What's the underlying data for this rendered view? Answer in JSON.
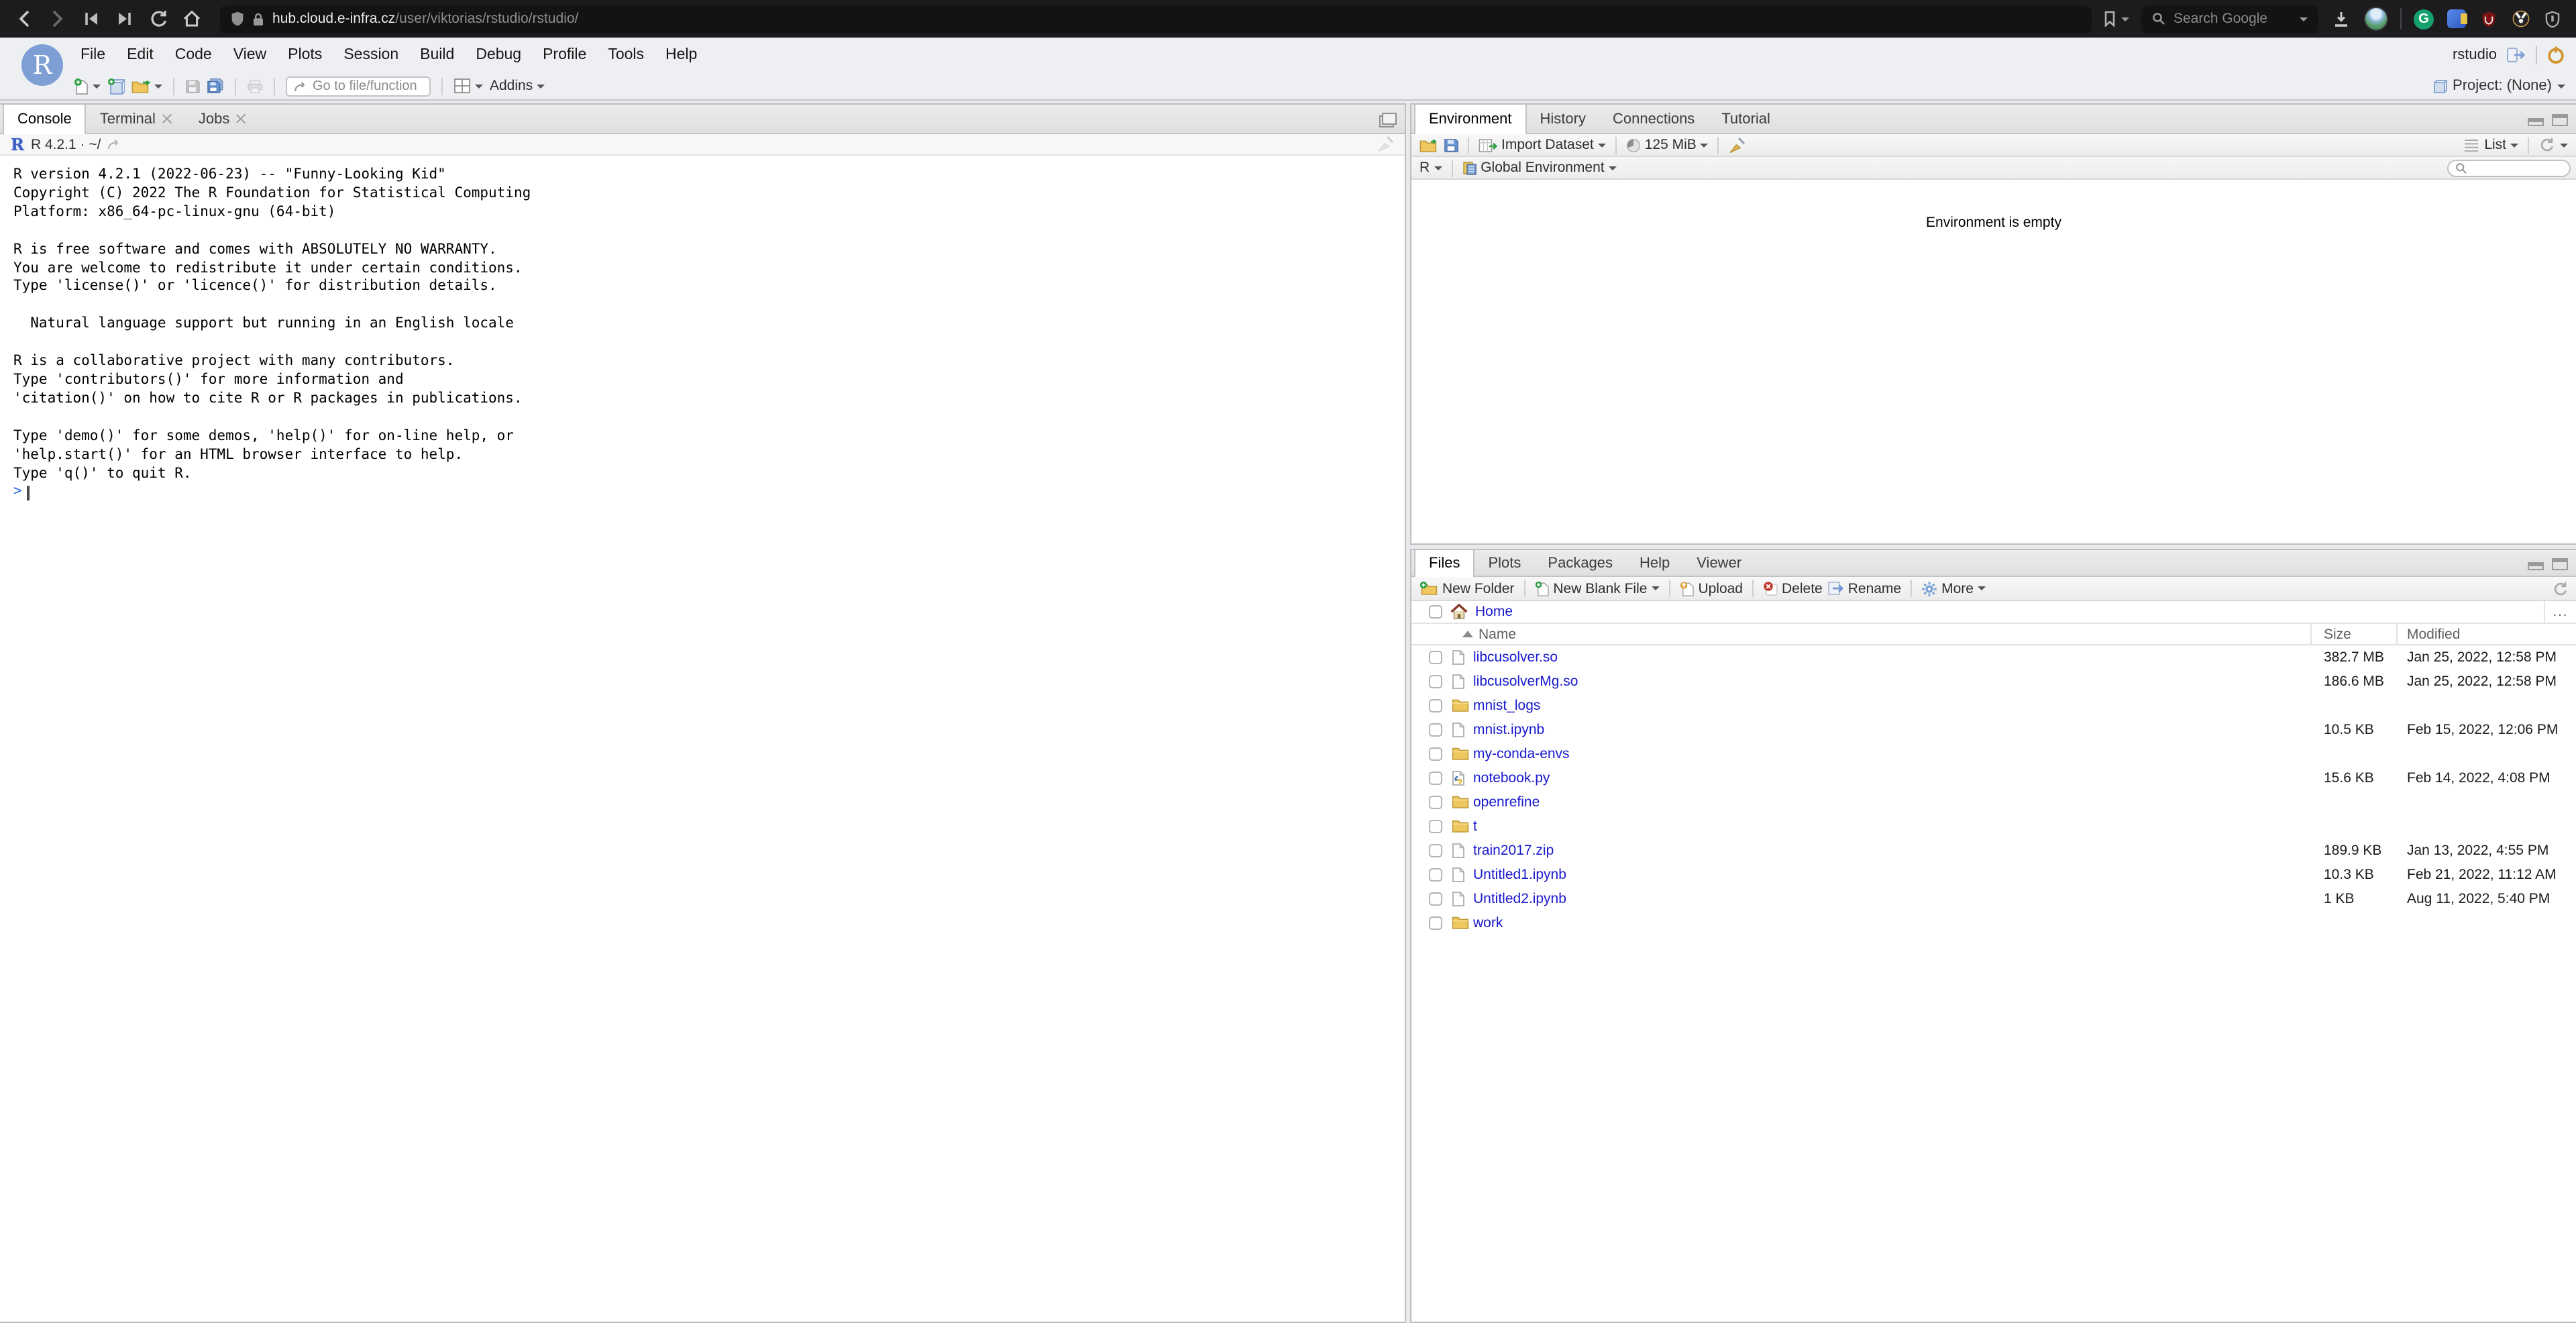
{
  "browser": {
    "url_domain": "hub.cloud.e-infra.cz",
    "url_path": "/user/viktorias/rstudio/rstudio/",
    "search_placeholder": "Search Google",
    "extension_g_label": "G"
  },
  "branding": {
    "r_logo": "R"
  },
  "menubar": {
    "items": [
      {
        "label": "File"
      },
      {
        "label": "Edit"
      },
      {
        "label": "Code"
      },
      {
        "label": "View"
      },
      {
        "label": "Plots"
      },
      {
        "label": "Session"
      },
      {
        "label": "Build"
      },
      {
        "label": "Debug"
      },
      {
        "label": "Profile"
      },
      {
        "label": "Tools"
      },
      {
        "label": "Help"
      }
    ],
    "session_label": "rstudio",
    "project_label": "Project: (None)"
  },
  "toolbar": {
    "goto_placeholder": "Go to file/function",
    "addins_label": "Addins"
  },
  "console": {
    "tabs": [
      {
        "label": "Console",
        "class": "active"
      },
      {
        "label": "Terminal",
        "class": "closable"
      },
      {
        "label": "Jobs",
        "class": "closable"
      }
    ],
    "header": "R 4.2.1 · ~/",
    "lines": [
      "R version 4.2.1 (2022-06-23) -- \"Funny-Looking Kid\"",
      "Copyright (C) 2022 The R Foundation for Statistical Computing",
      "Platform: x86_64-pc-linux-gnu (64-bit)",
      "",
      "R is free software and comes with ABSOLUTELY NO WARRANTY.",
      "You are welcome to redistribute it under certain conditions.",
      "Type 'license()' or 'licence()' for distribution details.",
      "",
      "  Natural language support but running in an English locale",
      "",
      "R is a collaborative project with many contributors.",
      "Type 'contributors()' for more information and",
      "'citation()' on how to cite R or R packages in publications.",
      "",
      "Type 'demo()' for some demos, 'help()' for on-line help, or",
      "'help.start()' for an HTML browser interface to help.",
      "Type 'q()' to quit R.",
      ""
    ],
    "prompt": ">"
  },
  "environment": {
    "tabs": [
      {
        "label": "Environment",
        "class": "active"
      },
      {
        "label": "History"
      },
      {
        "label": "Connections"
      },
      {
        "label": "Tutorial"
      }
    ],
    "import_label": "Import Dataset",
    "memory_label": "125 MiB",
    "list_label": "List",
    "lang_label": "R",
    "scope_label": "Global Environment",
    "empty_text": "Environment is empty"
  },
  "files": {
    "tabs": [
      {
        "label": "Files",
        "class": "active"
      },
      {
        "label": "Plots"
      },
      {
        "label": "Packages"
      },
      {
        "label": "Help"
      },
      {
        "label": "Viewer"
      }
    ],
    "toolbar": {
      "new_folder": "New Folder",
      "new_blank_file": "New Blank File",
      "upload": "Upload",
      "delete": "Delete",
      "rename": "Rename",
      "more": "More"
    },
    "breadcrumb": "Home",
    "more_cell": "...",
    "columns": {
      "name": "Name",
      "size": "Size",
      "modified": "Modified"
    },
    "rows": [
      {
        "name": "libcusolver.so",
        "class": "file",
        "size": "382.7 MB",
        "modified": "Jan 25, 2022, 12:58 PM"
      },
      {
        "name": "libcusolverMg.so",
        "class": "file",
        "size": "186.6 MB",
        "modified": "Jan 25, 2022, 12:58 PM"
      },
      {
        "name": "mnist_logs",
        "class": "folder",
        "size": "",
        "modified": ""
      },
      {
        "name": "mnist.ipynb",
        "class": "file",
        "size": "10.5 KB",
        "modified": "Feb 15, 2022, 12:06 PM"
      },
      {
        "name": "my-conda-envs",
        "class": "folder",
        "size": "",
        "modified": ""
      },
      {
        "name": "notebook.py",
        "class": "python",
        "size": "15.6 KB",
        "modified": "Feb 14, 2022, 4:08 PM"
      },
      {
        "name": "openrefine",
        "class": "folder",
        "size": "",
        "modified": ""
      },
      {
        "name": "t",
        "class": "folder",
        "size": "",
        "modified": ""
      },
      {
        "name": "train2017.zip",
        "class": "file",
        "size": "189.9 KB",
        "modified": "Jan 13, 2022, 4:55 PM"
      },
      {
        "name": "Untitled1.ipynb",
        "class": "file",
        "size": "10.3 KB",
        "modified": "Feb 21, 2022, 11:12 AM"
      },
      {
        "name": "Untitled2.ipynb",
        "class": "file",
        "size": "1 KB",
        "modified": "Aug 11, 2022, 5:40 PM"
      },
      {
        "name": "work",
        "class": "folder",
        "size": "",
        "modified": ""
      }
    ]
  }
}
